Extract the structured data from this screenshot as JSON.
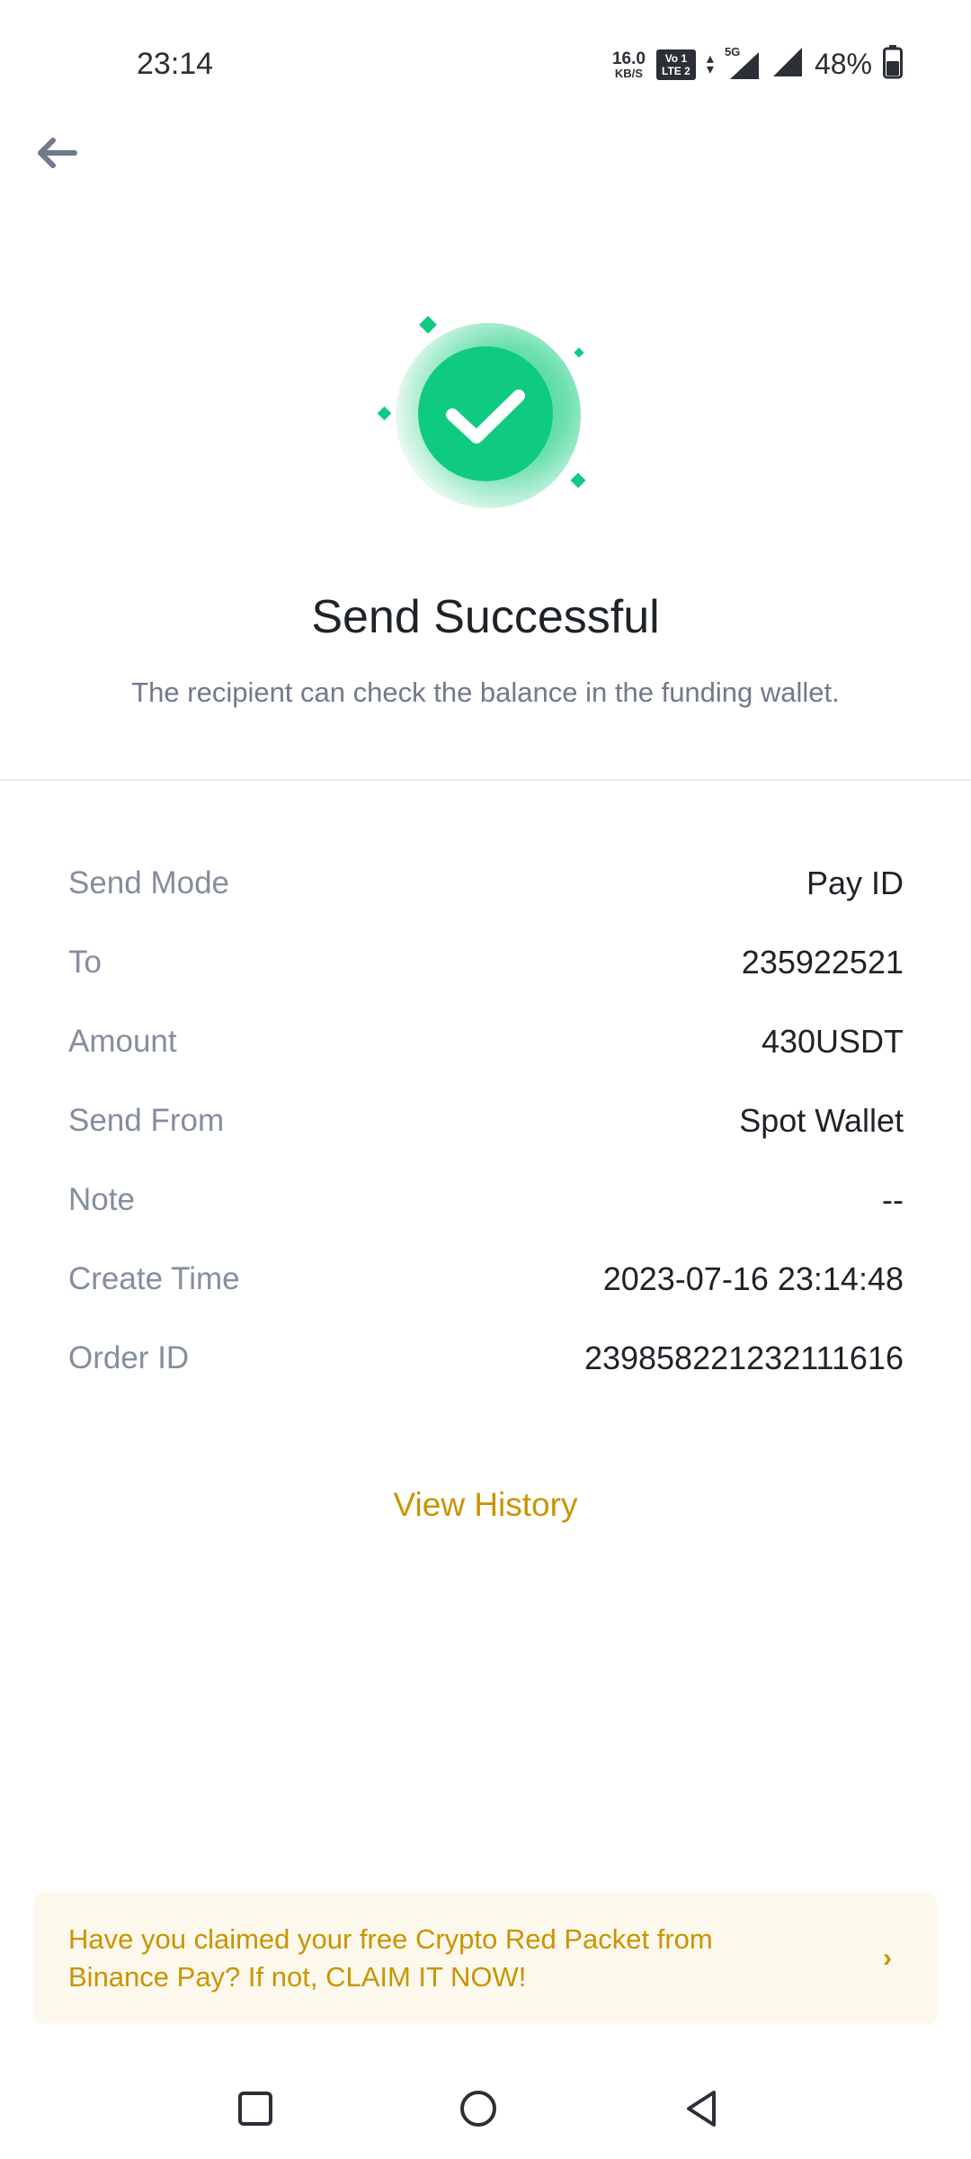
{
  "status_bar": {
    "time": "23:14",
    "net_speed_value": "16.0",
    "net_speed_unit": "KB/S",
    "volte_top": "Vo 1",
    "volte_bottom": "LTE 2",
    "network_type": "5G",
    "battery_percent": "48%"
  },
  "header": {
    "back_icon": "arrow-left-icon"
  },
  "result": {
    "icon": "check-circle-icon",
    "title": "Send Successful",
    "subtitle": "The recipient can check the balance in the funding wallet."
  },
  "details": [
    {
      "label": "Send Mode",
      "value": "Pay ID"
    },
    {
      "label": "To",
      "value": "235922521"
    },
    {
      "label": "Amount",
      "value": "430USDT"
    },
    {
      "label": "Send From",
      "value": "Spot Wallet"
    },
    {
      "label": "Note",
      "value": "--"
    },
    {
      "label": "Create Time",
      "value": "2023-07-16 23:14:48"
    },
    {
      "label": "Order ID",
      "value": "239858221232111616"
    }
  ],
  "actions": {
    "view_history_label": "View History"
  },
  "promo": {
    "text": "Have you claimed your free Crypto Red Packet from Binance Pay? If not, CLAIM IT NOW!",
    "chevron": "›"
  },
  "colors": {
    "accent": "#C99400",
    "success": "#0ECB81",
    "promo_bg": "#FDF8EC"
  }
}
